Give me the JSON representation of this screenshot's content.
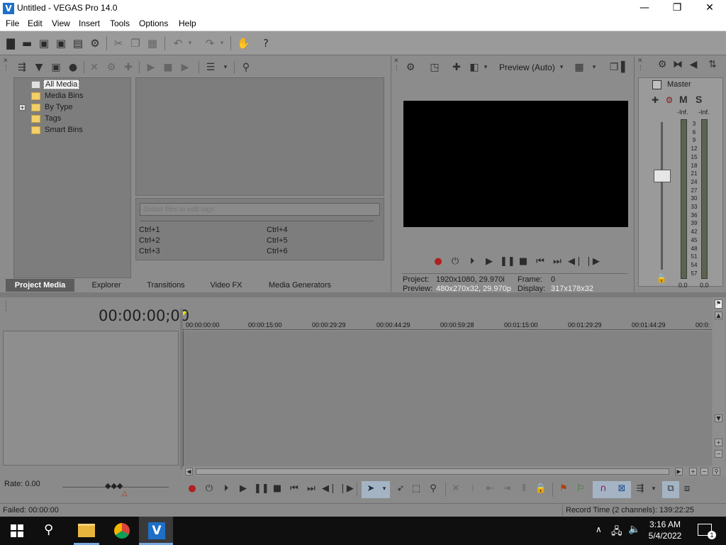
{
  "window": {
    "title": "Untitled - VEGAS Pro 14.0",
    "logo": "V",
    "minimize": "—",
    "maximize": "❐",
    "close": "✕"
  },
  "menu": [
    "File",
    "Edit",
    "View",
    "Insert",
    "Tools",
    "Options",
    "Help"
  ],
  "project_media": {
    "tree": [
      {
        "label": "All Media",
        "selected": true
      },
      {
        "label": "Media Bins"
      },
      {
        "label": "By Type",
        "expander": "+"
      },
      {
        "label": "Tags"
      },
      {
        "label": "Smart Bins"
      }
    ],
    "tags_placeholder": "Select files to edit tags",
    "shortcuts": [
      "Ctrl+1",
      "Ctrl+2",
      "Ctrl+3",
      "Ctrl+4",
      "Ctrl+5",
      "Ctrl+6"
    ],
    "tabs": [
      "Project Media",
      "Explorer",
      "Transitions",
      "Video FX",
      "Media Generators"
    ]
  },
  "preview": {
    "mode_label": "Preview (Auto)",
    "project_label": "Project:",
    "project_value": "1920x1080, 29.970i",
    "preview_label": "Preview:",
    "preview_value": "480x270x32, 29.970p",
    "frame_label": "Frame:",
    "frame_value": "0",
    "display_label": "Display:",
    "display_value": "317x178x32"
  },
  "master": {
    "label": "Master",
    "m": "M",
    "s": "S",
    "peak_left": "-Inf.",
    "peak_right": "-Inf.",
    "scale": [
      "3",
      "6",
      "9",
      "12",
      "15",
      "18",
      "21",
      "24",
      "27",
      "30",
      "33",
      "36",
      "39",
      "42",
      "45",
      "48",
      "51",
      "54",
      "57"
    ],
    "level_left": "0.0",
    "level_right": "0.0"
  },
  "timeline": {
    "timecode": "00:00:00;00",
    "ruler": [
      "00:00:00:00",
      "00:00:15:00",
      "00:00:29:29",
      "00:00:44:29",
      "00:00:59:28",
      "00:01:15:00",
      "00:01:29:29",
      "00:01:44:29",
      "00:0:"
    ]
  },
  "transport": {
    "rate": "Rate: 0.00"
  },
  "status": {
    "left": "Failed: 00:00:00",
    "right": "Record Time (2 channels): 139:22:25"
  },
  "taskbar": {
    "time": "3:16 AM",
    "date": "5/4/2022",
    "notifications": "1"
  }
}
